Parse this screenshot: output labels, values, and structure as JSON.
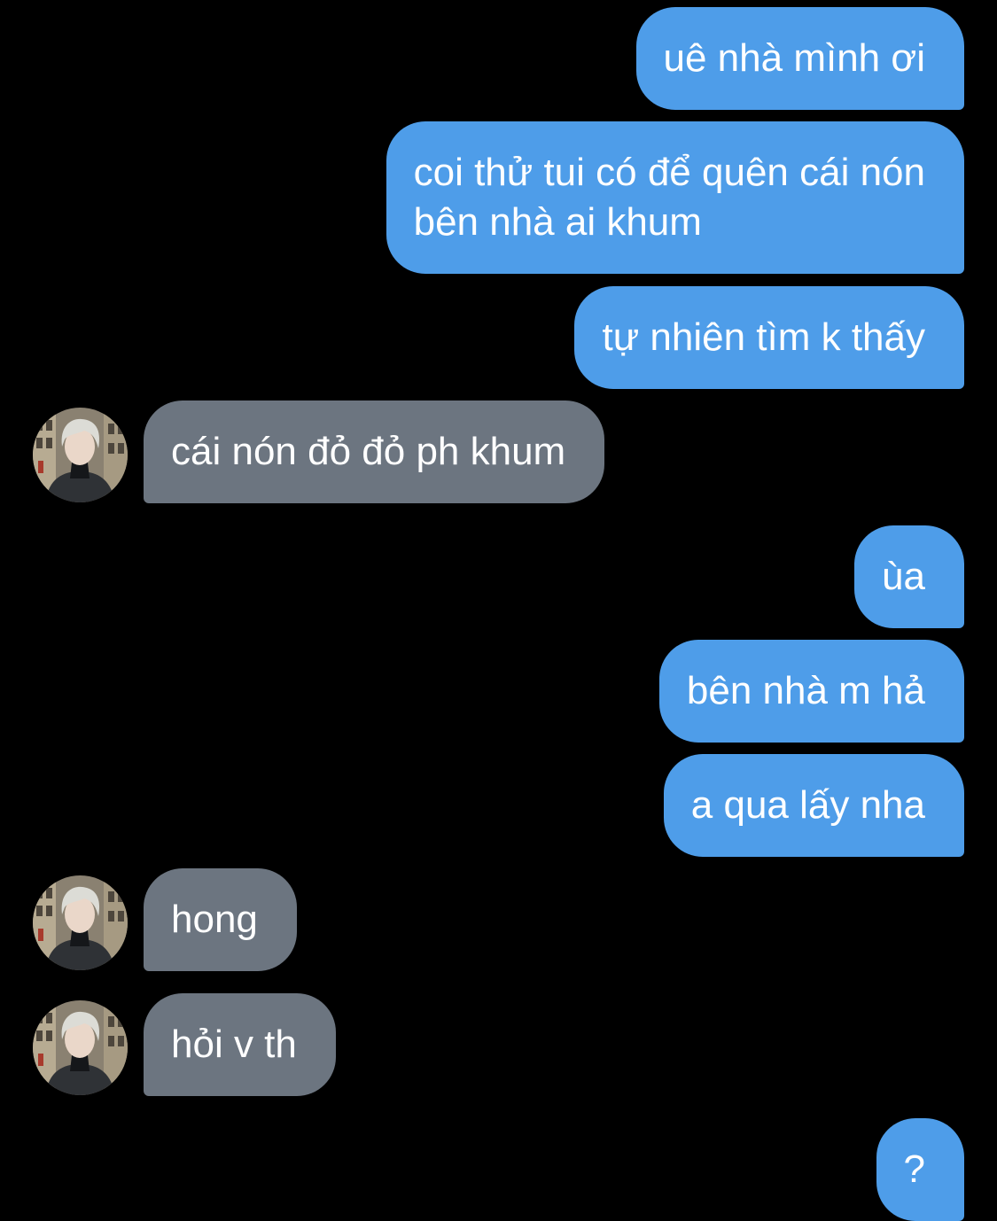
{
  "conversation": {
    "messages": [
      {
        "side": "sent",
        "text": "uê nhà mình ơi"
      },
      {
        "side": "sent",
        "text": "coi thử tui có để quên cái nón\nbên nhà ai khum"
      },
      {
        "side": "sent",
        "text": "tự nhiên tìm k thấy"
      },
      {
        "side": "received",
        "text": "cái nón đỏ đỏ ph khum"
      },
      {
        "side": "sent",
        "text": "ùa"
      },
      {
        "side": "sent",
        "text": "bên nhà m hả"
      },
      {
        "side": "sent",
        "text": "a qua lấy nha"
      },
      {
        "side": "received",
        "text": "hong"
      },
      {
        "side": "received",
        "text": "hỏi v th"
      },
      {
        "side": "sent",
        "text": "?"
      }
    ]
  },
  "colors": {
    "sent_bubble": "#4e9de9",
    "received_bubble": "#6c7580",
    "background": "#000000",
    "text": "#ffffff"
  },
  "icons": {
    "contact_avatar": "contact-avatar-photo"
  }
}
